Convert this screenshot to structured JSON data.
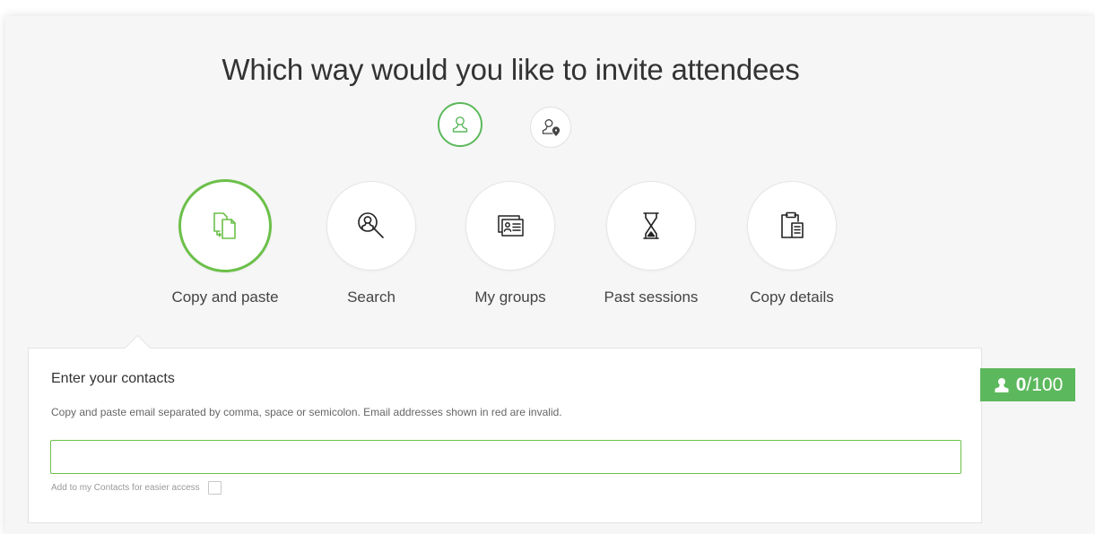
{
  "page": {
    "title": "Which way would you like to invite attendees"
  },
  "mode_toggle": {
    "internal_icon": "person-icon",
    "external_icon": "person-location-icon"
  },
  "methods": [
    {
      "label": "Copy and paste",
      "icon": "copy-paste-icon",
      "active": true
    },
    {
      "label": "Search",
      "icon": "search-person-icon",
      "active": false
    },
    {
      "label": "My groups",
      "icon": "groups-icon",
      "active": false
    },
    {
      "label": "Past sessions",
      "icon": "hourglass-icon",
      "active": false
    },
    {
      "label": "Copy details",
      "icon": "clipboard-icon",
      "active": false
    }
  ],
  "contacts": {
    "heading": "Enter your contacts",
    "help_text": "Copy and paste email separated by comma, space or semicolon. Email addresses shown in red are invalid.",
    "input_value": "",
    "add_to_contacts_label": "Add to my Contacts for easier access"
  },
  "counter": {
    "count": "0",
    "separator": "/",
    "limit": "100",
    "icon": "user-icon"
  },
  "colors": {
    "accent": "#6cc04a",
    "counter_bg": "#5cb85c",
    "panel_bg": "#f6f6f6"
  }
}
